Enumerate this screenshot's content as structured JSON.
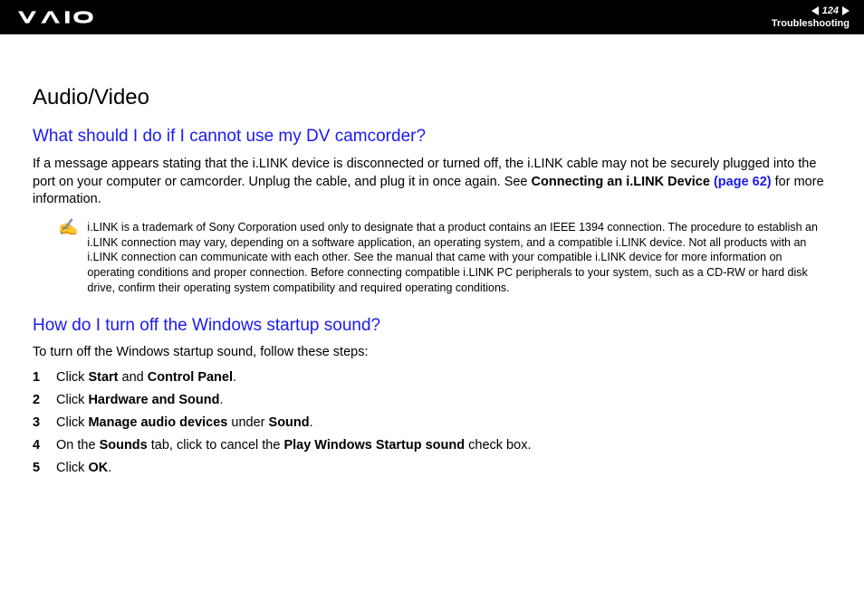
{
  "header": {
    "page_number": "124",
    "section": "Troubleshooting"
  },
  "title": "Audio/Video",
  "q1": {
    "heading": "What should I do if I cannot use my DV camcorder?",
    "p1_a": "If a message appears stating that the i.LINK device is disconnected or turned off, the i.LINK cable may not be securely plugged into the port on your computer or camcorder. Unplug the cable, and plug it in once again. See ",
    "p1_b": "Connecting an i.LINK Device",
    "p1_c": " (page 62)",
    "p1_d": " for more information.",
    "note": "i.LINK is a trademark of Sony Corporation used only to designate that a product contains an IEEE 1394 connection. The procedure to establish an i.LINK connection may vary, depending on a software application, an operating system, and a compatible i.LINK device. Not all products with an i.LINK connection can communicate with each other. See the manual that came with your compatible i.LINK device for more information on operating conditions and proper connection. Before connecting compatible i.LINK PC peripherals to your system, such as a CD-RW or hard disk drive, confirm their operating system compatibility and required operating conditions."
  },
  "q2": {
    "heading": "How do I turn off the Windows startup sound?",
    "intro": "To turn off the Windows startup sound, follow these steps:",
    "steps": [
      {
        "a": "Click ",
        "b": "Start",
        "c": " and ",
        "d": "Control Panel",
        "e": "."
      },
      {
        "a": "Click ",
        "b": "Hardware and Sound",
        "c": "."
      },
      {
        "a": "Click ",
        "b": "Manage audio devices",
        "c": " under ",
        "d": "Sound",
        "e": "."
      },
      {
        "a": "On the ",
        "b": "Sounds",
        "c": " tab, click to cancel the ",
        "d": "Play Windows Startup sound",
        "e": " check box."
      },
      {
        "a": "Click ",
        "b": "OK",
        "c": "."
      }
    ]
  }
}
